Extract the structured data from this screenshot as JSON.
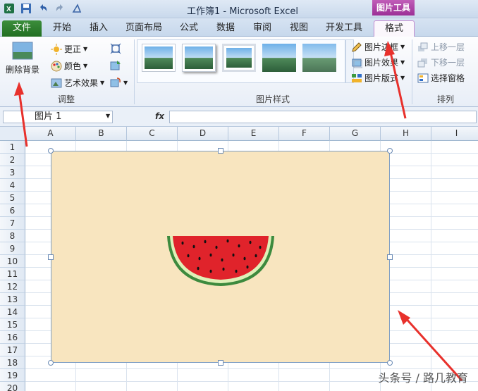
{
  "window": {
    "title": "工作簿1 - Microsoft Excel",
    "context_tab": "图片工具"
  },
  "tabs": [
    "文件",
    "开始",
    "插入",
    "页面布局",
    "公式",
    "数据",
    "审阅",
    "视图",
    "开发工具",
    "格式"
  ],
  "ribbon": {
    "adjust": {
      "remove_bg": "删除背景",
      "corrections": "更正",
      "color": "颜色",
      "artistic": "艺术效果",
      "label": "调整"
    },
    "picture_styles": {
      "border": "图片边框",
      "effects": "图片效果",
      "layout": "图片版式",
      "label": "图片样式"
    },
    "arrange": {
      "bring_forward": "上移一层",
      "send_backward": "下移一层",
      "selection_pane": "选择窗格",
      "label": "排列"
    }
  },
  "formula_bar": {
    "name_box": "图片 1",
    "fx": "fx"
  },
  "columns": [
    "A",
    "B",
    "C",
    "D",
    "E",
    "F",
    "G",
    "H",
    "I"
  ],
  "rows": [
    "1",
    "2",
    "3",
    "4",
    "5",
    "6",
    "7",
    "8",
    "9",
    "10",
    "11",
    "12",
    "13",
    "14",
    "15",
    "16",
    "17",
    "18",
    "19",
    "20"
  ],
  "watermark": "头条号 / 路几教育",
  "colors": {
    "accent_tab": "#9c2f96",
    "file_tab": "#2a7a2a",
    "picture_bg": "#f8e5bf",
    "watermelon_red": "#e0232b",
    "rind_green": "#3d8a3e",
    "arrow_red": "#e8312c"
  }
}
